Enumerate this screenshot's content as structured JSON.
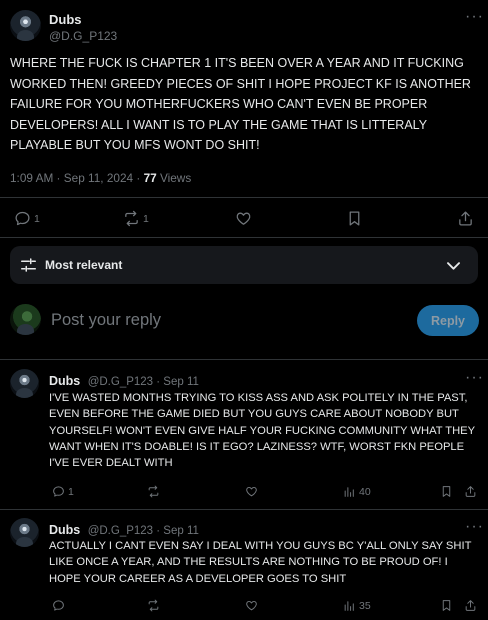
{
  "tweet": {
    "author_name": "Dubs",
    "author_handle": "@D.G_P123",
    "text": "WHERE THE FUCK IS CHAPTER 1 IT'S BEEN OVER A YEAR AND IT FUCKING WORKED THEN! GREEDY PIECES OF SHIT I HOPE PROJECT KF IS ANOTHER FAILURE FOR YOU MOTHERFUCKERS WHO CAN'T EVEN BE PROPER DEVELOPERS! ALL I WANT IS TO PLAY THE GAME THAT IS LITTERALY PLAYABLE BUT YOU MFS WONT DO SHIT!",
    "time": "1:09 AM · Sep 11, 2024 · ",
    "views_count": "77",
    "views_label": " Views",
    "reply_count": "1",
    "retweet_count": "1"
  },
  "sort": {
    "label": "Most relevant"
  },
  "composer": {
    "placeholder": "Post your reply",
    "reply_button": "Reply"
  },
  "replies": [
    {
      "author_name": "Dubs",
      "meta": "@D.G_P123 · Sep 11",
      "text": "I'VE WASTED MONTHS TRYING TO KISS ASS AND ASK POLITELY IN THE PAST, EVEN BEFORE THE GAME DIED BUT YOU GUYS CARE ABOUT NOBODY BUT YOURSELF! WON'T EVEN GIVE HALF YOUR FUCKING COMMUNITY WHAT THEY WANT WHEN IT'S DOABLE! IS IT EGO? LAZINESS? WTF, WORST FKN PEOPLE I'VE EVER DEALT WITH",
      "reply_count": "1",
      "views": "40"
    },
    {
      "author_name": "Dubs",
      "meta": "@D.G_P123 · Sep 11",
      "text": "ACTUALLY I CANT EVEN SAY I DEAL WITH YOU GUYS BC Y'ALL ONLY SAY SHIT LIKE ONCE A YEAR, AND THE RESULTS ARE NOTHING TO BE PROUD OF! I HOPE YOUR CAREER AS A DEVELOPER GOES TO SHIT",
      "views": "35"
    }
  ],
  "colors": {
    "background": "#000000",
    "text": "#e7e9ea",
    "muted": "#71767b",
    "divider": "#2f3336",
    "reply_button": "#1d9bf0",
    "sort_bar": "#16181c"
  },
  "icons": [
    "more-icon",
    "reply-icon",
    "retweet-icon",
    "like-icon",
    "bookmark-icon",
    "share-icon",
    "sort-sliders-icon",
    "chevron-down-icon",
    "views-chart-icon"
  ]
}
